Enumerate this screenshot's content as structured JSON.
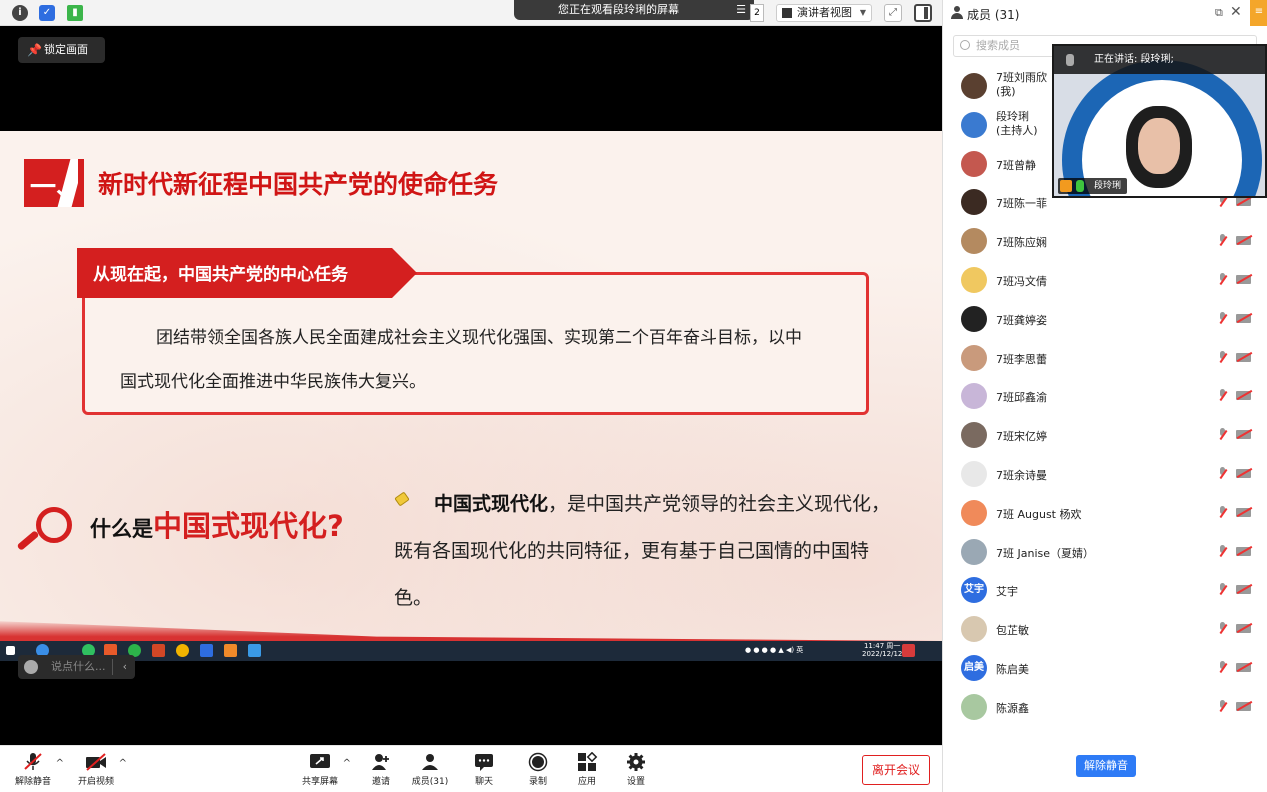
{
  "topbar": {
    "watching_banner": "您正在观看段玲琍的屏幕",
    "view_mode": "演讲者视图"
  },
  "lock_screen_label": "锁定画面",
  "slide": {
    "section_number": "一、",
    "title": "新时代新征程中国共产党的使命任务",
    "tag_label": "从现在起，中国共产党的中心任务",
    "task_line1": "团结带领全国各族人民全面建成社会主义现代化强国、实现第二个百年奋斗目标，以中",
    "task_line2": "国式现代化全面推进中华民族伟大复兴。",
    "question_prefix": "什么是",
    "question_highlight": "中国式现代化?",
    "definition_bold": "中国式现代化",
    "definition_rest1": "，是中国共产党领导的社会主义现代化，",
    "definition_line2": "既有各国现代化的共同特征，更有基于自己国情的中国特",
    "definition_line3": "色。"
  },
  "shared_taskbar": {
    "time": "11:47 周一",
    "date": "2022/12/12"
  },
  "chat_placeholder": "说点什么...",
  "toolbar": {
    "unmute": "解除静音",
    "start_video": "开启视频",
    "share_screen": "共享屏幕",
    "invite": "邀请",
    "members": "成员(31)",
    "chat": "聊天",
    "record": "录制",
    "apps": "应用",
    "settings": "设置",
    "leave": "离开会议"
  },
  "panel": {
    "title": "成员 (31)",
    "search_placeholder": "搜索成员",
    "unmute_all": "解除静音"
  },
  "speaker": {
    "speaking_label": "正在讲话: 段玲琍;",
    "name": "段玲琍"
  },
  "members": [
    {
      "name": "7班刘雨欣",
      "role": "(我)",
      "avatar_color": "#5a4030",
      "initials": ""
    },
    {
      "name": "段玲琍",
      "role": "(主持人)",
      "avatar_color": "#3a7ad0",
      "initials": ""
    },
    {
      "name": "7班曾静",
      "role": "",
      "avatar_color": "#c4584f",
      "initials": ""
    },
    {
      "name": "7班陈一菲",
      "role": "",
      "avatar_color": "#3b2a22",
      "initials": ""
    },
    {
      "name": "7班陈应娴",
      "role": "",
      "avatar_color": "#b48a60",
      "initials": ""
    },
    {
      "name": "7班冯文倩",
      "role": "",
      "avatar_color": "#f0c860",
      "initials": ""
    },
    {
      "name": "7班龚婷姿",
      "role": "",
      "avatar_color": "#222222",
      "initials": ""
    },
    {
      "name": "7班李思蕾",
      "role": "",
      "avatar_color": "#c99a7c",
      "initials": ""
    },
    {
      "name": "7班邱鑫渝",
      "role": "",
      "avatar_color": "#c8b6d8",
      "initials": ""
    },
    {
      "name": "7班宋亿婷",
      "role": "",
      "avatar_color": "#7a6a60",
      "initials": ""
    },
    {
      "name": "7班余诗曼",
      "role": "",
      "avatar_color": "#e8e8e8",
      "initials": ""
    },
    {
      "name": "7班 August 杨欢",
      "role": "",
      "avatar_color": "#f08a5a",
      "initials": ""
    },
    {
      "name": "7班 Janise（夏婧）",
      "role": "",
      "avatar_color": "#9aa8b4",
      "initials": ""
    },
    {
      "name": "艾宇",
      "role": "",
      "avatar_color": "#2e6de0",
      "initials": "艾宇"
    },
    {
      "name": "包芷敏",
      "role": "",
      "avatar_color": "#d8c8b0",
      "initials": ""
    },
    {
      "name": "陈启美",
      "role": "",
      "avatar_color": "#2e6de0",
      "initials": "启美"
    },
    {
      "name": "陈源鑫",
      "role": "",
      "avatar_color": "#a8c8a0",
      "initials": ""
    }
  ]
}
